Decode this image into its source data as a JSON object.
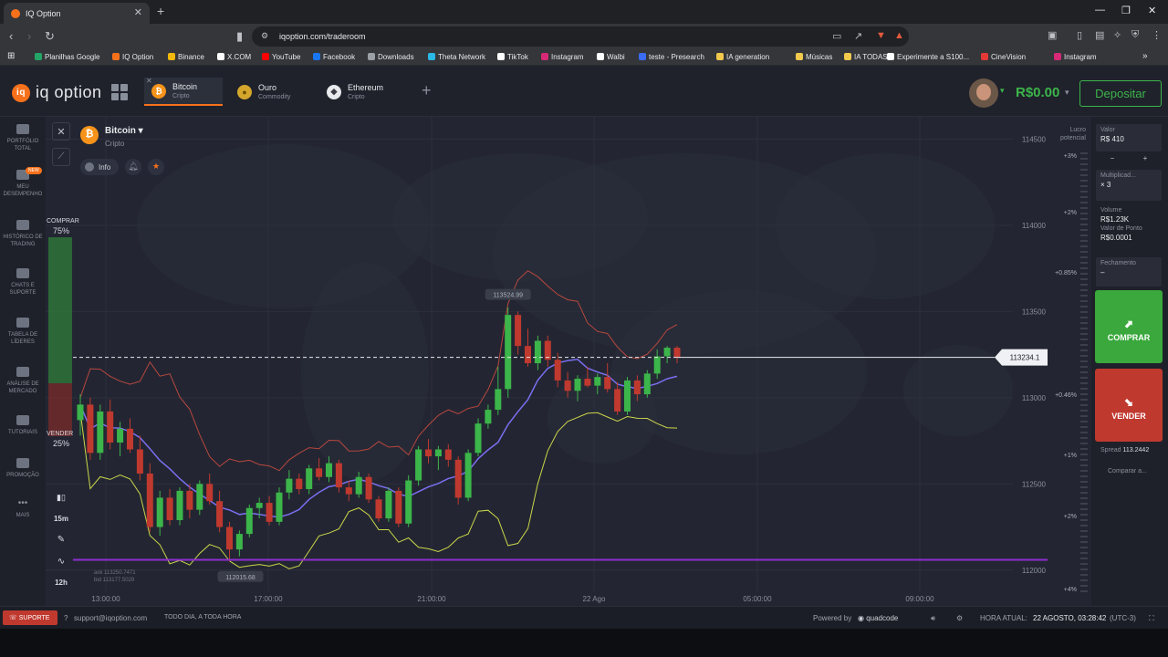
{
  "browser": {
    "tab_title": "IQ Option",
    "tab_close": "✕",
    "new_tab": "+",
    "url": "iqoption.com/traderoom",
    "bookmarks": [
      {
        "label": "Planilhas Google",
        "color": "#23a566"
      },
      {
        "label": "IQ Option",
        "color": "#f7711b"
      },
      {
        "label": "Binance",
        "color": "#f0b90b"
      },
      {
        "label": "X.COM",
        "color": "#ffffff"
      },
      {
        "label": "YouTube",
        "color": "#ff0000"
      },
      {
        "label": "Facebook",
        "color": "#1877f2"
      },
      {
        "label": "Downloads",
        "color": "#9aa0a6"
      },
      {
        "label": "Theta Network",
        "color": "#2ab8e6"
      },
      {
        "label": "TikTok",
        "color": "#ffffff"
      },
      {
        "label": "Instagram",
        "color": "#d62976"
      },
      {
        "label": "Walbi",
        "color": "#ffffff"
      },
      {
        "label": "teste - Presearch",
        "color": "#3b6cf6"
      },
      {
        "label": "IA generation",
        "color": "#f2c94c"
      },
      {
        "label": "Músicas",
        "color": "#f2c94c"
      },
      {
        "label": "IA TODAS",
        "color": "#f2c94c"
      },
      {
        "label": "Experimente a S100...",
        "color": "#ffffff"
      },
      {
        "label": "CineVision",
        "color": "#e53935"
      },
      {
        "label": "Instagram",
        "color": "#d62976"
      }
    ]
  },
  "header": {
    "logo_text": "iq option",
    "asset_tabs": [
      {
        "name": "Bitcoin",
        "type": "Cripto",
        "icon_color": "#f7931a",
        "icon_glyph": "₿"
      },
      {
        "name": "Ouro",
        "type": "Commodity",
        "icon_color": "#d4a72c",
        "icon_glyph": "●"
      },
      {
        "name": "Ethereum",
        "type": "Cripto",
        "icon_color": "#3b3d45",
        "icon_glyph": "◆"
      }
    ],
    "balance": "R$0.00",
    "deposit_label": "Depositar"
  },
  "sidebar": [
    {
      "label": "PORTFÓLIO TOTAL",
      "icon": "briefcase-icon"
    },
    {
      "label": "MEU DESEMPENHO",
      "icon": "performance-icon",
      "badge": "NEW"
    },
    {
      "label": "HISTÓRICO DE TRADING",
      "icon": "history-icon"
    },
    {
      "label": "CHATS E SUPORTE",
      "icon": "chat-icon"
    },
    {
      "label": "TABELA DE LÍDERES",
      "icon": "trophy-icon"
    },
    {
      "label": "ANÁLISE DE MERCADO",
      "icon": "analysis-icon"
    },
    {
      "label": "TUTORIAIS",
      "icon": "tutorial-icon"
    },
    {
      "label": "PROMOÇÃO",
      "icon": "promo-icon"
    },
    {
      "label": "MAIS",
      "icon": "more-icon"
    }
  ],
  "asset": {
    "name": "Bitcoin",
    "type": "Cripto",
    "info_label": "Info"
  },
  "sentiment": {
    "buy_label": "COMPRAR",
    "buy_pct": "75%",
    "sell_label": "VENDER",
    "sell_pct": "25%"
  },
  "tools": {
    "timeframe": "15m",
    "period": "12h"
  },
  "quote": {
    "ask": "ask 113250.7471",
    "bid": "bid 113177.5029"
  },
  "chart_data": {
    "type": "candlestick",
    "current_price": "113234.1",
    "high_label": "113524.99",
    "low_label": "112015.68",
    "y_ticks": [
      "114500",
      "114000",
      "113500",
      "113000",
      "112500",
      "112000"
    ],
    "y_tick_values": [
      114500,
      114000,
      113500,
      113000,
      112500,
      112000
    ],
    "ylim": [
      111930,
      114550
    ],
    "pct_ticks": [
      "+3%",
      "+2%",
      "+0.85%",
      "+0.46%",
      "+1%",
      "+2%",
      "+4%"
    ],
    "x_ticks": [
      "13:00:00",
      "17:00:00",
      "21:00:00",
      "22 Ago",
      "05:00:00",
      "09:00:00"
    ],
    "profit_label": "Lucro potencial",
    "colors": {
      "up": "#3cb54a",
      "down": "#c0392f",
      "upper_band": "#b8473f",
      "lower_band": "#cbd64a",
      "ma": "#7a6ff0",
      "horizontal": "#8f2fd1"
    },
    "candles": [
      [
        112870,
        113020,
        112780,
        112960
      ],
      [
        112960,
        113000,
        112640,
        112680
      ],
      [
        112680,
        112960,
        112640,
        112920
      ],
      [
        112920,
        112990,
        112700,
        112740
      ],
      [
        112740,
        112860,
        112660,
        112820
      ],
      [
        112820,
        112880,
        112680,
        112700
      ],
      [
        112700,
        112780,
        112520,
        112560
      ],
      [
        112560,
        112620,
        112220,
        112250
      ],
      [
        112250,
        112460,
        112200,
        112420
      ],
      [
        112420,
        112470,
        112260,
        112290
      ],
      [
        112290,
        112480,
        112260,
        112460
      ],
      [
        112460,
        112500,
        112300,
        112350
      ],
      [
        112350,
        112520,
        112320,
        112500
      ],
      [
        112500,
        112560,
        112380,
        112400
      ],
      [
        112400,
        112460,
        112220,
        112250
      ],
      [
        112250,
        112280,
        112050,
        112120
      ],
      [
        112120,
        112230,
        112080,
        112210
      ],
      [
        112210,
        112380,
        112190,
        112360
      ],
      [
        112360,
        112420,
        112300,
        112390
      ],
      [
        112390,
        112430,
        112260,
        112280
      ],
      [
        112280,
        112480,
        112260,
        112450
      ],
      [
        112450,
        112580,
        112410,
        112530
      ],
      [
        112530,
        112560,
        112440,
        112470
      ],
      [
        112470,
        112610,
        112440,
        112590
      ],
      [
        112590,
        112650,
        112520,
        112540
      ],
      [
        112540,
        112660,
        112510,
        112620
      ],
      [
        112620,
        112640,
        112450,
        112480
      ],
      [
        112480,
        112520,
        112400,
        112440
      ],
      [
        112440,
        112570,
        112420,
        112540
      ],
      [
        112540,
        112560,
        112390,
        112410
      ],
      [
        112410,
        112430,
        112280,
        112300
      ],
      [
        112300,
        112480,
        112280,
        112460
      ],
      [
        112460,
        112480,
        112250,
        112270
      ],
      [
        112270,
        112550,
        112250,
        112520
      ],
      [
        112520,
        112720,
        112490,
        112700
      ],
      [
        112700,
        112760,
        112620,
        112660
      ],
      [
        112660,
        112720,
        112580,
        112700
      ],
      [
        112700,
        112730,
        112600,
        112640
      ],
      [
        112640,
        112660,
        112380,
        112420
      ],
      [
        112420,
        112700,
        112400,
        112680
      ],
      [
        112680,
        112880,
        112660,
        112850
      ],
      [
        112850,
        112960,
        112820,
        112930
      ],
      [
        112930,
        113180,
        112900,
        113050
      ],
      [
        113050,
        113524,
        113000,
        113480
      ],
      [
        113480,
        113500,
        113250,
        113300
      ],
      [
        113300,
        113400,
        113180,
        113200
      ],
      [
        113200,
        113360,
        113160,
        113330
      ],
      [
        113330,
        113360,
        113180,
        113220
      ],
      [
        113220,
        113260,
        113060,
        113100
      ],
      [
        113100,
        113150,
        113000,
        113040
      ],
      [
        113040,
        113130,
        112980,
        113110
      ],
      [
        113110,
        113180,
        113060,
        113070
      ],
      [
        113070,
        113140,
        113020,
        113120
      ],
      [
        113120,
        113200,
        113030,
        113050
      ],
      [
        113050,
        113090,
        112900,
        112920
      ],
      [
        112920,
        113120,
        112900,
        113100
      ],
      [
        113100,
        113130,
        112980,
        113020
      ],
      [
        113020,
        113160,
        113000,
        113140
      ],
      [
        113140,
        113280,
        113110,
        113240
      ],
      [
        113240,
        113300,
        113200,
        113290
      ],
      [
        113290,
        113300,
        113200,
        113234
      ]
    ]
  },
  "trade_panel": {
    "value_label": "Valor",
    "value": "R$ 410",
    "minus": "−",
    "plus": "+",
    "multiplier_label": "Multiplicad...",
    "multiplier": "× 3",
    "volume_label": "Volume",
    "volume": "R$1.23K",
    "point_label": "Valor de Ponto",
    "point": "R$0.0001",
    "close_label": "Fechamento",
    "close_value": "–",
    "buy_label": "COMPRAR",
    "sell_label": "VENDER",
    "spread_label": "Spread",
    "spread_value": "113.2442",
    "compare_label": "Comparar a..."
  },
  "footer": {
    "support_label": "SUPORTE",
    "email": "support@iqoption.com",
    "hours": "TODO DIA, A TODA HORA",
    "powered": "Powered by",
    "powered_brand": "quadcode",
    "time_label": "HORA ATUAL:",
    "time_value": "22 AGOSTO, 03:28:42",
    "tz": "(UTC-3)"
  }
}
